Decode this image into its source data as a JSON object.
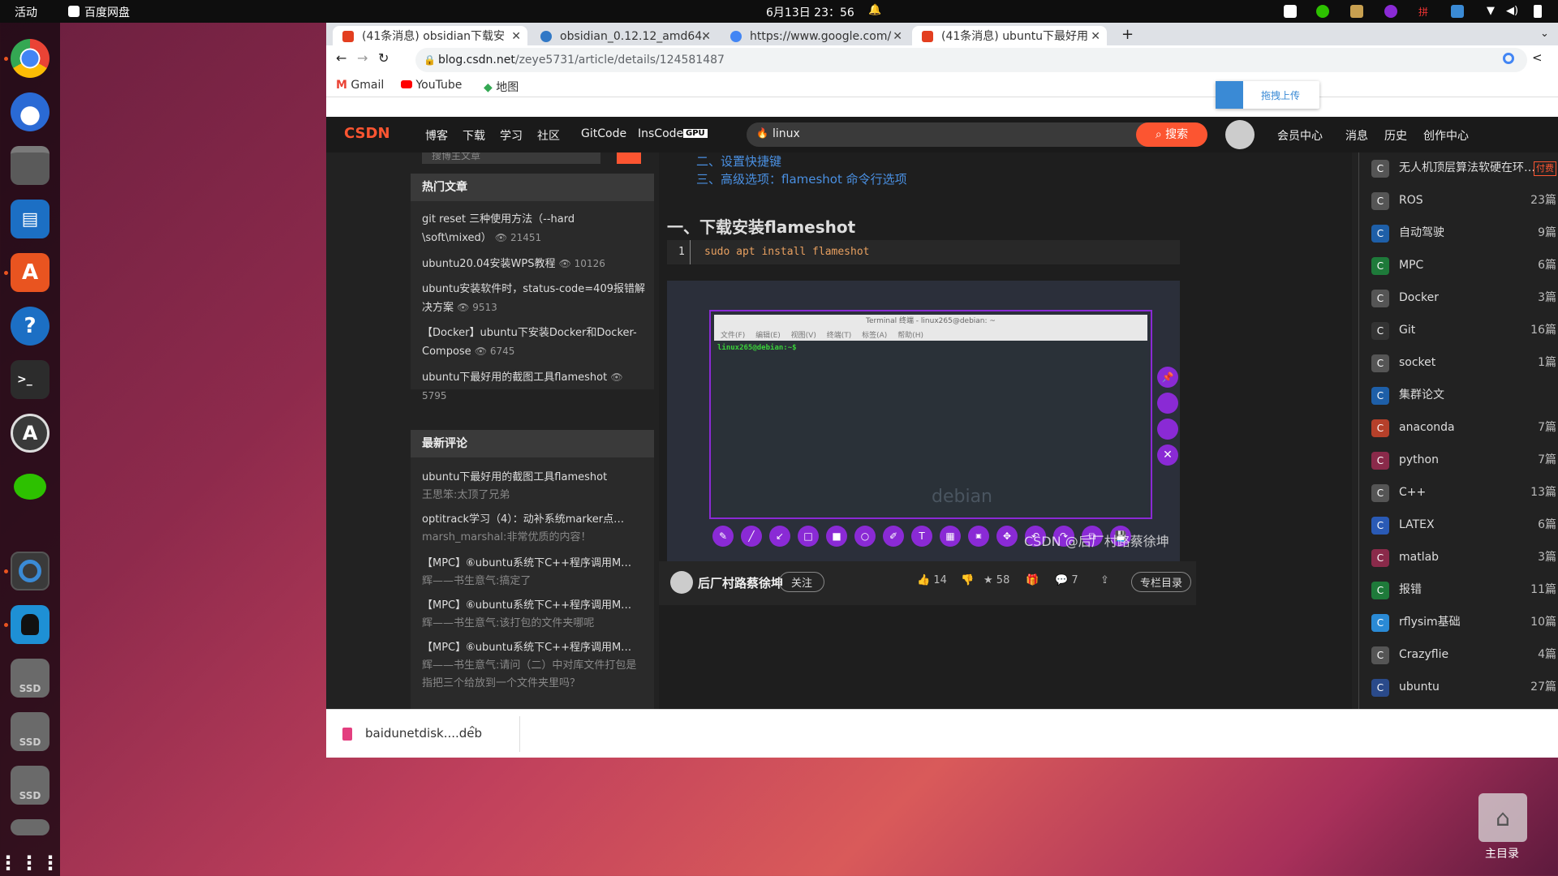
{
  "topbar": {
    "activities": "活动",
    "app": "百度网盘",
    "clock": "6月13日 23：56"
  },
  "dock": {
    "items": [
      "chrome-icon",
      "thunderbird-icon",
      "files-icon",
      "writer-icon",
      "appcenter-icon",
      "help-icon",
      "terminal-icon",
      "software-updater-icon",
      "wechat-icon",
      "baidu-netdisk-icon",
      "qq-icon",
      "ssd-drive-icon",
      "ssd-drive-icon",
      "ssd-drive-icon",
      "trash-icon",
      "show-apps-icon"
    ],
    "ssd": "SSD"
  },
  "browser": {
    "tabs": [
      {
        "label": "(41条消息) obsidian下载安",
        "fav": "#e33e1f"
      },
      {
        "label": "obsidian_0.12.12_amd64.",
        "fav": "#3178c6"
      },
      {
        "label": "https://www.google.com/",
        "fav": "#4285f4"
      },
      {
        "label": "(41条消息) ubuntu下最好用",
        "fav": "#e33e1f"
      }
    ],
    "new_tab": "+",
    "url_domain": "blog.csdn.net",
    "url_path": "/zeye5731/article/details/124581487",
    "bookmarks": [
      {
        "label": "Gmail",
        "color": "#ea4335"
      },
      {
        "label": "YouTube",
        "color": "#ff0000"
      },
      {
        "label": "地图",
        "color": "#34a853"
      }
    ]
  },
  "baidu_float": {
    "label": "拖拽上传"
  },
  "csdn": {
    "logo": "CSDN",
    "nav": [
      "博客",
      "下载",
      "学习",
      "社区",
      "GitCode",
      "InsCode"
    ],
    "gpu": "GPU",
    "search_value": "linux",
    "search_button": "搜索",
    "right_nav": [
      "会员中心",
      "消息",
      "历史",
      "创作中心"
    ]
  },
  "left": {
    "search_placeholder": "搜博主文章",
    "hot_title": "热门文章",
    "hot": [
      {
        "title": "git reset 三种使用方法（--hard \\soft\\mixed）",
        "views": "21451"
      },
      {
        "title": "ubuntu20.04安装WPS教程",
        "views": "10126"
      },
      {
        "title": "ubuntu安装软件时，status-code=409报错解决方案",
        "views": "9513"
      },
      {
        "title": "【Docker】ubuntu下安装Docker和Docker-Compose",
        "views": "6745"
      },
      {
        "title": "ubuntu下最好用的截图工具flameshot",
        "views": "5795"
      }
    ],
    "comment_title": "最新评论",
    "comments": [
      {
        "title": "ubuntu下最好用的截图工具flameshot",
        "user": "王思笨:",
        "text": "太顶了兄弟"
      },
      {
        "title": "optitrack学习（4）：动补系统marker点…",
        "user": "marsh_marshal:",
        "text": "非常优质的内容！"
      },
      {
        "title": "【MPC】⑥ubuntu系统下C++程序调用M…",
        "user": "辉——书生意气:",
        "text": "搞定了"
      },
      {
        "title": "【MPC】⑥ubuntu系统下C++程序调用M…",
        "user": "辉——书生意气:",
        "text": "该打包的文件夹哪呢"
      },
      {
        "title": "【MPC】⑥ubuntu系统下C++程序调用M…",
        "user": "辉——书生意气:",
        "text": "请问（二）中对库文件打包是指把三个给放到一个文件夹里吗？"
      }
    ]
  },
  "article": {
    "toc": [
      "二、设置快捷键",
      "三、高级选项：flameshot 命令行选项"
    ],
    "heading": "一、下载安装flameshot",
    "code_line_no": "1",
    "code": "sudo apt install flameshot",
    "terminal_title": "Terminal 终端 - linux265@debian: ~",
    "terminal_menu": [
      "文件(F)",
      "编辑(E)",
      "视图(V)",
      "终端(T)",
      "标签(A)",
      "帮助(H)"
    ],
    "prompt": "linux265@debian:~$",
    "debian": "debian",
    "watermark": "CSDN @后厂村路蔡徐坤",
    "author": "后厂村路蔡徐坤",
    "follow": "关注",
    "likes": "14",
    "stars": "58",
    "comments": "7",
    "column": "专栏目录"
  },
  "right": {
    "items": [
      {
        "name": "无人机顶层算法软硬在环…",
        "count": "付费",
        "color": "#555"
      },
      {
        "name": "ROS",
        "count": "23篇",
        "color": "#555"
      },
      {
        "name": "自动驾驶",
        "count": "9篇",
        "color": "#1e5fa8"
      },
      {
        "name": "MPC",
        "count": "6篇",
        "color": "#1e7a3a"
      },
      {
        "name": "Docker",
        "count": "3篇",
        "color": "#555"
      },
      {
        "name": "Git",
        "count": "16篇",
        "color": "#333"
      },
      {
        "name": "socket",
        "count": "1篇",
        "color": "#555"
      },
      {
        "name": "集群论文",
        "count": "",
        "color": "#1e5fa8"
      },
      {
        "name": "anaconda",
        "count": "7篇",
        "color": "#b5402a"
      },
      {
        "name": "python",
        "count": "7篇",
        "color": "#8a2a4a"
      },
      {
        "name": "C++",
        "count": "13篇",
        "color": "#555"
      },
      {
        "name": "LATEX",
        "count": "6篇",
        "color": "#2a5ab5"
      },
      {
        "name": "matlab",
        "count": "3篇",
        "color": "#8a2a4a"
      },
      {
        "name": "报错",
        "count": "11篇",
        "color": "#1e7a3a"
      },
      {
        "name": "rflysim基础",
        "count": "10篇",
        "color": "#2a8ad5"
      },
      {
        "name": "Crazyflie",
        "count": "4篇",
        "color": "#555"
      },
      {
        "name": "ubuntu",
        "count": "27篇",
        "color": "#2a4a8a"
      }
    ]
  },
  "download": {
    "file": "baidunetdisk....deb"
  },
  "desktop": {
    "home": "主目录"
  }
}
